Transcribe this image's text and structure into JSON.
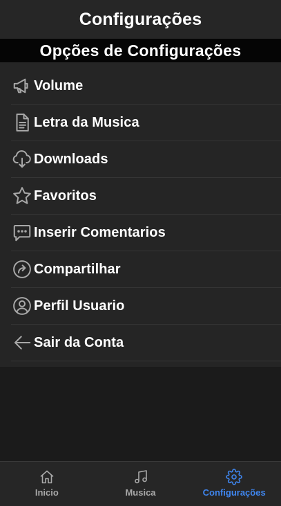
{
  "header": {
    "title": "Configurações"
  },
  "section": {
    "title": "Opções de Configurações"
  },
  "menu": {
    "items": [
      {
        "label": "Volume",
        "icon": "megaphone-icon"
      },
      {
        "label": "Letra da Musica",
        "icon": "document-icon"
      },
      {
        "label": "Downloads",
        "icon": "cloud-download-icon"
      },
      {
        "label": "Favoritos",
        "icon": "star-icon"
      },
      {
        "label": "Inserir Comentarios",
        "icon": "chat-bubble-icon"
      },
      {
        "label": "Compartilhar",
        "icon": "share-arrow-icon"
      },
      {
        "label": "Perfil Usuario",
        "icon": "user-circle-icon"
      },
      {
        "label": "Sair da Conta",
        "icon": "arrow-left-icon"
      }
    ]
  },
  "tabs": [
    {
      "label": "Inicio",
      "icon": "home-icon",
      "active": false
    },
    {
      "label": "Musica",
      "icon": "music-note-icon",
      "active": false
    },
    {
      "label": "Configurações",
      "icon": "gear-icon",
      "active": true
    }
  ],
  "colors": {
    "background": "#1b1b1b",
    "header": "#262626",
    "section_bar": "#050505",
    "panel": "#252525",
    "text": "#ffffff",
    "icon": "#a8a8a8",
    "accent": "#3f86ef"
  }
}
